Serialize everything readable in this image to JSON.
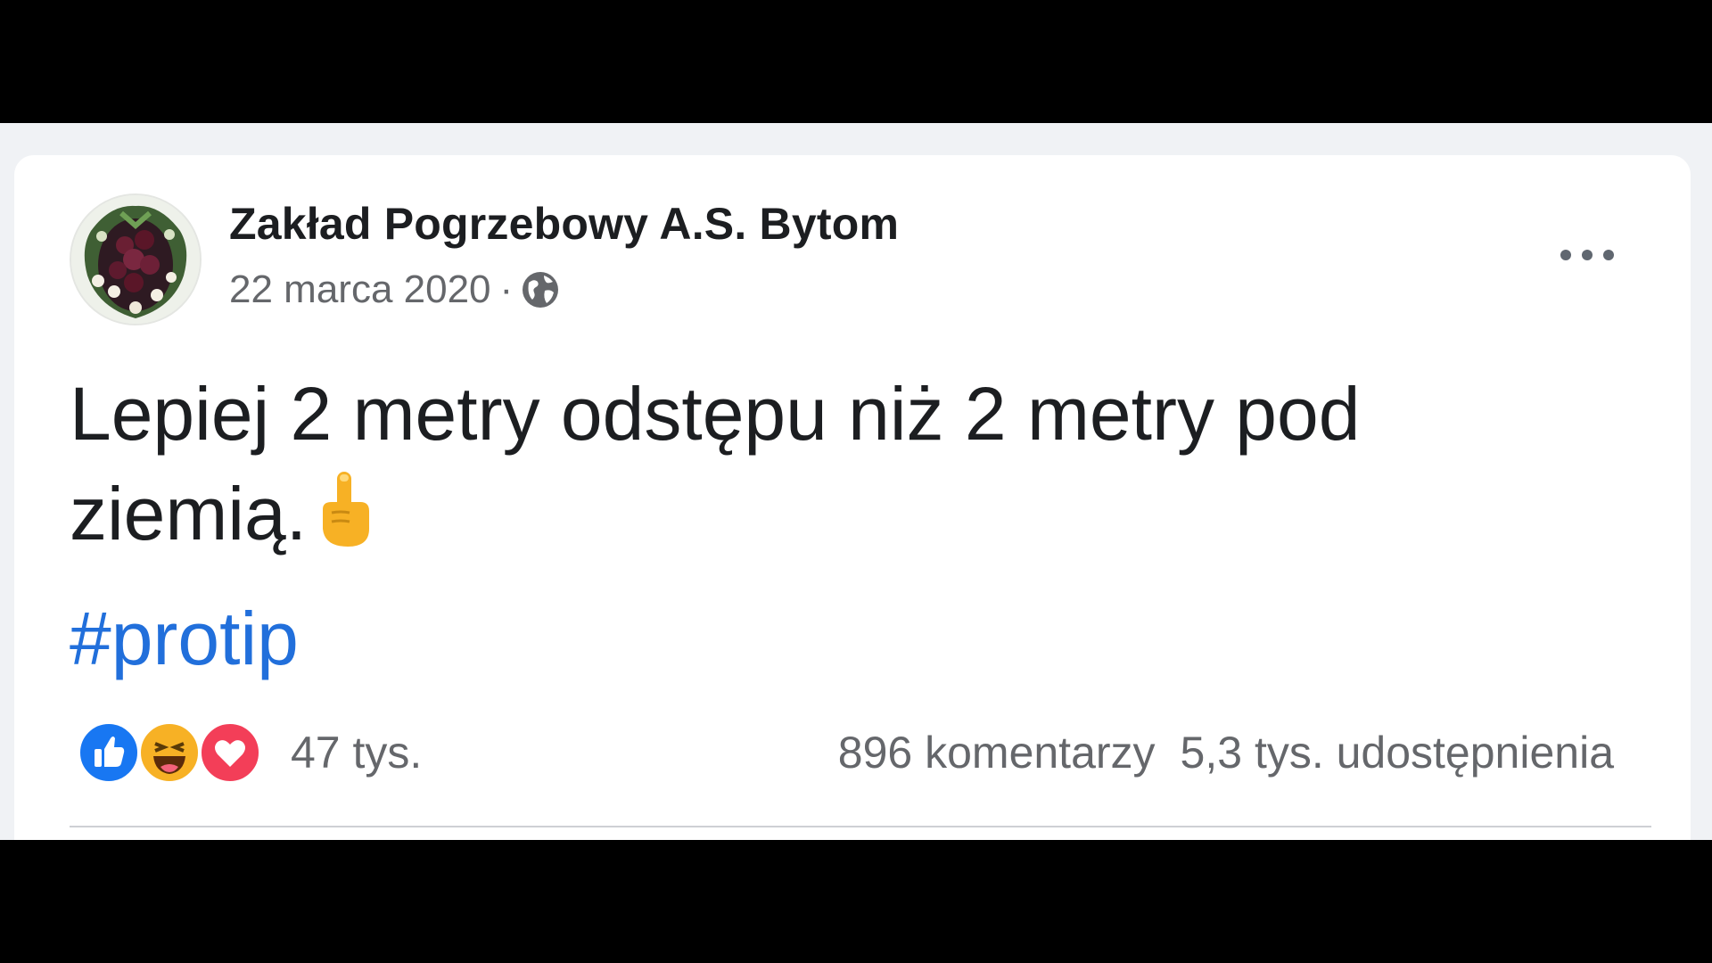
{
  "post": {
    "author": "Zakład Pogrzebowy A.S. Bytom",
    "date": "22 marca 2020",
    "separator": "·",
    "visibility_icon": "globe-icon",
    "text_line1": "Lepiej 2 metry odstępu niż 2 metry pod",
    "text_line2": "ziemią.",
    "emoji_icon": "index-pointing-up-emoji",
    "hashtag": "#protip"
  },
  "engagement": {
    "reaction_icons": [
      "like-icon",
      "haha-icon",
      "love-icon"
    ],
    "reaction_count": "47 tys.",
    "comments": "896 komentarzy",
    "shares": "5,3 tys. udostępnienia"
  },
  "colors": {
    "hashtag": "#216fdb",
    "like": "#1877f2",
    "love": "#f33e58",
    "haha": "#f7b125",
    "muted_text": "#65676b"
  }
}
